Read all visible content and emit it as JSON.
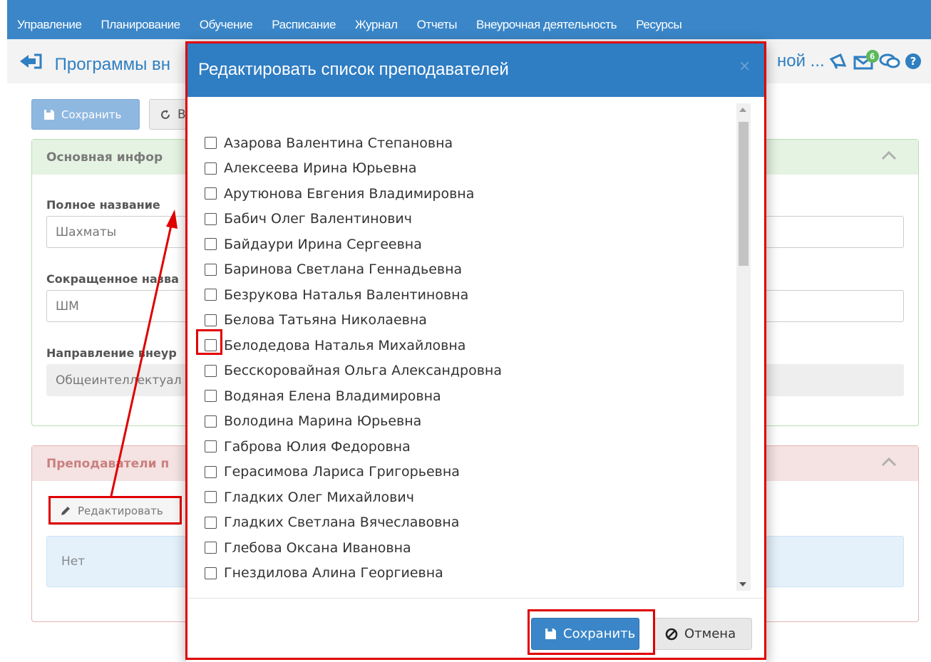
{
  "nav": {
    "items": [
      "Управление",
      "Планирование",
      "Обучение",
      "Расписание",
      "Журнал",
      "Отчеты",
      "Внеурочная деятельность",
      "Ресурсы"
    ]
  },
  "header": {
    "title": "Программы вн",
    "title_right": "ной ...",
    "notifications_count": "6"
  },
  "toolbar": {
    "save_label": "Сохранить",
    "reset_label": "В"
  },
  "main_info": {
    "heading": "Основная инфор",
    "full_name_label": "Полное название",
    "full_name_value": "Шахматы",
    "short_name_label": "Сокращенное назва",
    "short_name_value": "ШМ",
    "direction_label": "Направление внеур",
    "direction_value": "Общеинтеллектуал"
  },
  "teachers_panel": {
    "heading": "Преподаватели п",
    "edit_label": "Редактировать",
    "empty_text": "Нет"
  },
  "modal": {
    "title": "Редактировать список преподавателей",
    "close": "×",
    "teachers": [
      "Азарова Валентина Степановна",
      "Алексеева Ирина Юрьевна",
      "Арутюнова Евгения Владимировна",
      "Бабич Олег Валентинович",
      "Байдаури Ирина Сергеевна",
      "Баринова Светлана Геннадьевна",
      "Безрукова Наталья Валентиновна",
      "Белова Татьяна Николаевна",
      "Белодедова Наталья Михайловна",
      "Бесскоровайная Ольга Александровна",
      "Водяная Елена Владимировна",
      "Володина Марина Юрьевна",
      "Габрова Юлия Федоровна",
      "Герасимова Лариса Григорьевна",
      "Гладких Олег Михайлович",
      "Гладких Светлана Вячеславовна",
      "Глебова Оксана Ивановна",
      "Гнездилова Алина Георгиевна"
    ],
    "save_label": "Сохранить",
    "cancel_label": "Отмена"
  },
  "colors": {
    "header_blue": "#2f7dc3",
    "highlight_red": "#e00000",
    "primary_button": "#3a86c8"
  }
}
